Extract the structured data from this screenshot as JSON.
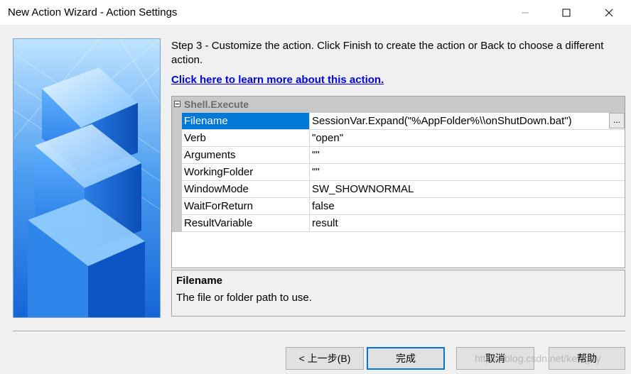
{
  "window": {
    "title": "New Action Wizard - Action Settings",
    "controls": {
      "minimize": "—",
      "maximize": "☐",
      "close": "✕"
    }
  },
  "content": {
    "step_text": "Step 3 - Customize the action.  Click Finish to create the action or Back to choose a different action.",
    "learn_more_link": "Click here to learn more about this action."
  },
  "property_grid": {
    "category": "Shell.Execute",
    "rows": [
      {
        "name": "Filename",
        "value": "SessionVar.Expand(\"%AppFolder%\\\\onShutDown.bat\")",
        "selected": true
      },
      {
        "name": "Verb",
        "value": "\"open\""
      },
      {
        "name": "Arguments",
        "value": "\"\""
      },
      {
        "name": "WorkingFolder",
        "value": "\"\""
      },
      {
        "name": "WindowMode",
        "value": "SW_SHOWNORMAL"
      },
      {
        "name": "WaitForReturn",
        "value": "false"
      },
      {
        "name": "ResultVariable",
        "value": "result"
      }
    ],
    "ellipsis_label": "..."
  },
  "description": {
    "title": "Filename",
    "text": "The file or folder path to use."
  },
  "buttons": {
    "back": "< 上一步(B)",
    "finish": "完成",
    "cancel": "取消",
    "help": "帮助"
  },
  "watermark": "https://blog.csdn.net/keleguy",
  "colors": {
    "selection": "#0078d7",
    "link": "#0000ee",
    "category_bg": "#c8c8c8",
    "image_blue": "#2e7fe0"
  }
}
